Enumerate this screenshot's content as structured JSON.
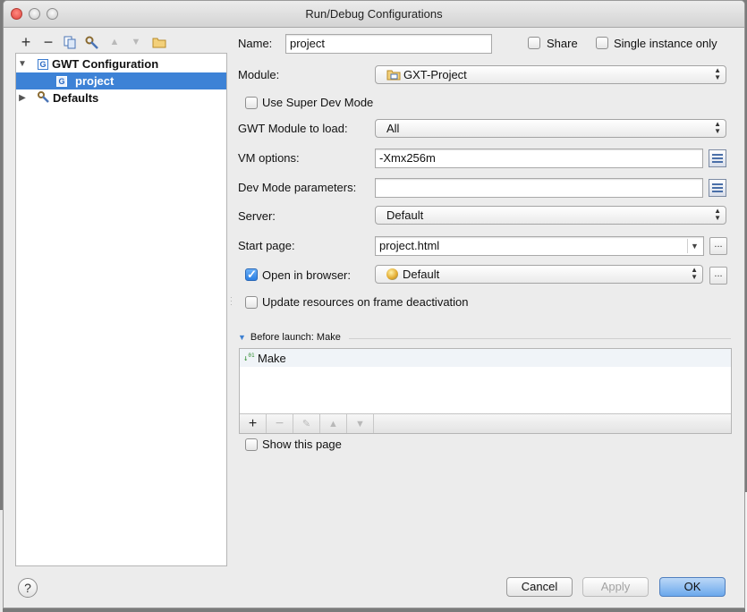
{
  "window": {
    "title": "Run/Debug Configurations"
  },
  "left_toolbar": {
    "add": "+",
    "remove": "−"
  },
  "tree": {
    "items": [
      {
        "label": "GWT Configuration",
        "icon": "gwt-config-icon",
        "expanded": true
      },
      {
        "label": "project",
        "icon": "gwt-config-icon",
        "selected": true
      },
      {
        "label": "Defaults",
        "icon": "wrench-icon",
        "expanded": false
      }
    ]
  },
  "form": {
    "name_label": "Name:",
    "name_value": "project",
    "share_label": "Share",
    "share_checked": false,
    "single_instance_label": "Single instance only",
    "single_instance_checked": false,
    "module_label": "Module:",
    "module_value": "GXT-Project",
    "super_dev_label": "Use Super Dev Mode",
    "super_dev_checked": false,
    "gwt_module_label": "GWT Module to load:",
    "gwt_module_value": "All",
    "vm_options_label": "VM options:",
    "vm_options_value": "-Xmx256m",
    "dev_mode_label": "Dev Mode parameters:",
    "dev_mode_value": "",
    "server_label": "Server:",
    "server_value": "Default",
    "start_page_label": "Start page:",
    "start_page_value": "project.html",
    "open_browser_label": "Open in browser:",
    "open_browser_checked": true,
    "browser_value": "Default",
    "update_resources_label": "Update resources on frame deactivation",
    "update_resources_checked": false,
    "dots": "..."
  },
  "before_launch": {
    "title": "Before launch: Make",
    "items": [
      {
        "label": "Make",
        "icon": "make-icon"
      }
    ],
    "add": "+",
    "remove": "−",
    "show_page_label": "Show this page",
    "show_page_checked": false
  },
  "buttons": {
    "help": "?",
    "cancel": "Cancel",
    "apply": "Apply",
    "ok": "OK"
  },
  "colors": {
    "selection": "#3d82d6",
    "primary_button": "#6ba8ec"
  }
}
